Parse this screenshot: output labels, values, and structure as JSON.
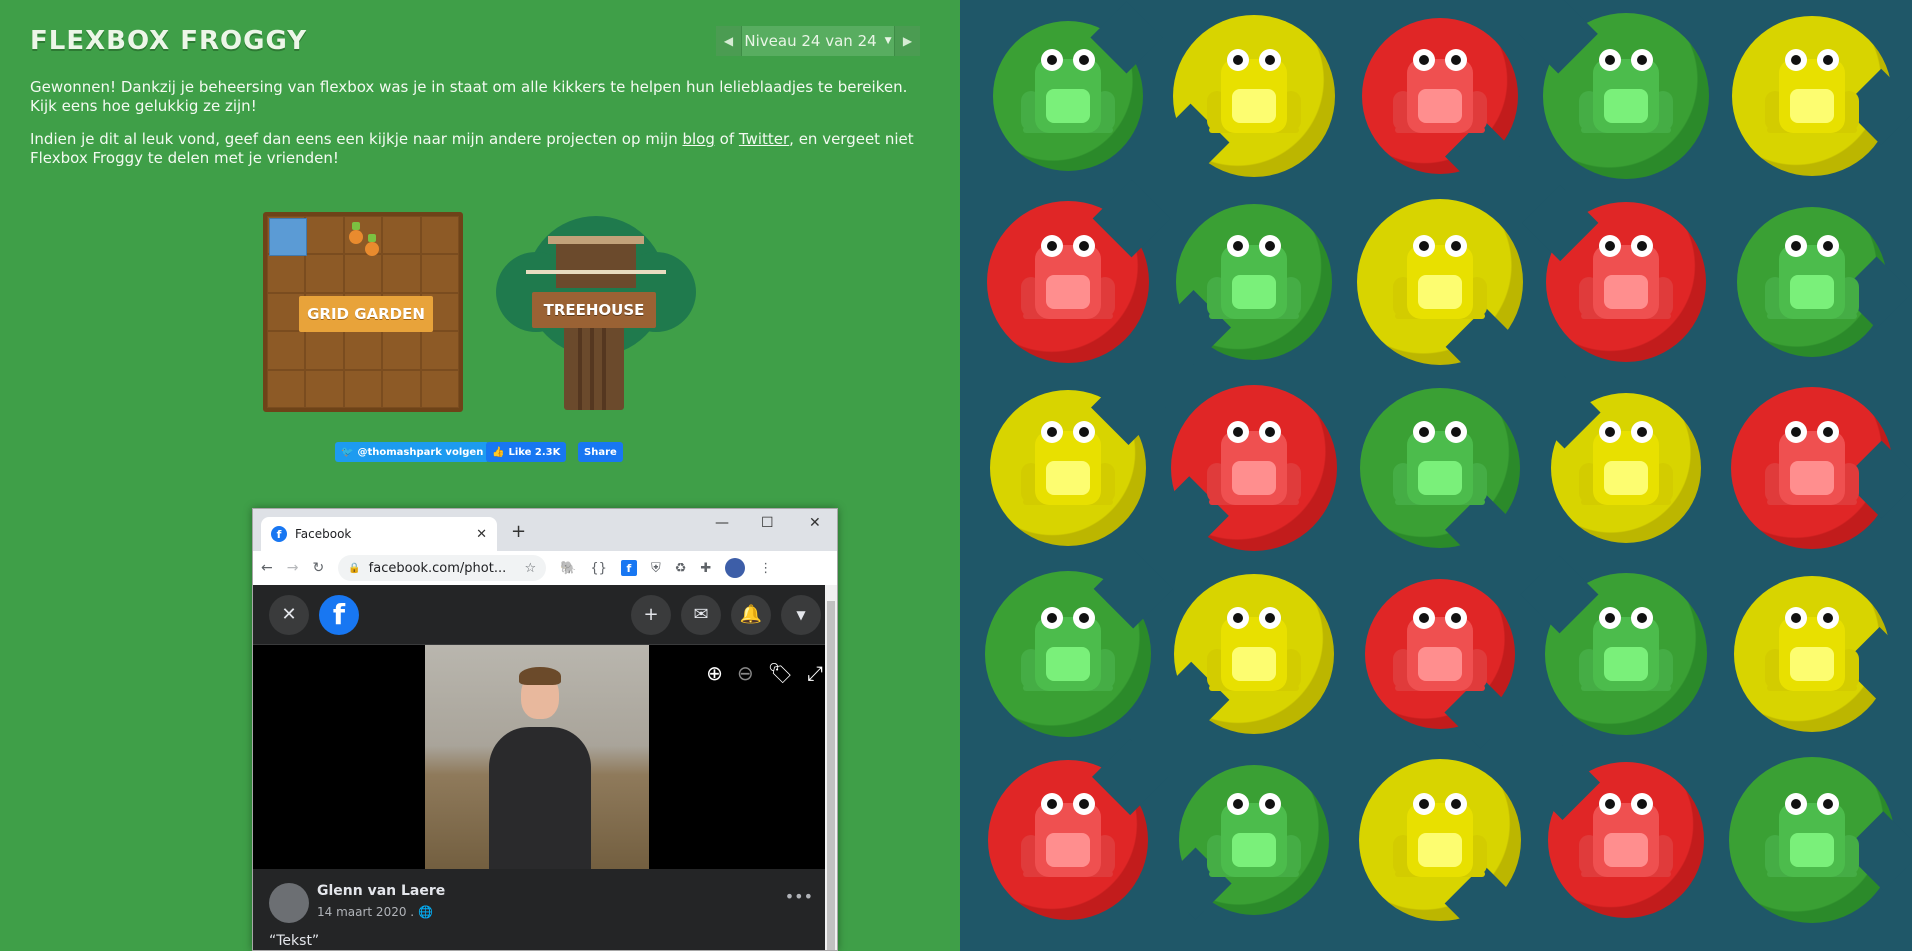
{
  "game": {
    "title": "FLEXBOX FROGGY",
    "level_label": "Niveau 24 van 24",
    "win_text": "Gewonnen! Dankzij je beheersing van flexbox was je in staat om alle kikkers te helpen hun lelieblaadjes te bereiken. Kijk eens hoe gelukkig ze zijn!",
    "share_text_pre": "Indien je dit al leuk vond, geef dan eens een kijkje naar mijn andere projecten op mijn ",
    "share_link_blog": "blog",
    "share_text_mid": " of ",
    "share_link_twitter": "Twitter",
    "share_text_post": ", en vergeet niet Flexbox Froggy te delen met je vrienden!"
  },
  "promos": {
    "grid_garden": "GRID GARDEN",
    "treehouse": "TREEHOUSE"
  },
  "social": {
    "twitter_follow": "@thomashpark volgen",
    "fb_like": "Like 2.3K",
    "fb_share": "Share"
  },
  "browser": {
    "tab_title": "Facebook",
    "url": "facebook.com/phot...",
    "post_author": "Glenn van Laere",
    "post_date": "14 maart 2020 .",
    "post_text": "“Tekst”"
  },
  "board": {
    "colors": {
      "green": "#3aa034",
      "green_dark": "#2b8a2a",
      "yellow": "#d8d400",
      "yellow_dark": "#bcb600",
      "red": "#e02626",
      "red_dark": "#c21c1c",
      "water": "#1f5768"
    },
    "rows": [
      [
        "green",
        "yellow",
        "red",
        "green",
        "yellow"
      ],
      [
        "red",
        "green",
        "yellow",
        "red",
        "green"
      ],
      [
        "yellow",
        "red",
        "green",
        "yellow",
        "red"
      ],
      [
        "green",
        "yellow",
        "red",
        "green",
        "yellow"
      ],
      [
        "red",
        "green",
        "yellow",
        "red",
        "green"
      ]
    ]
  }
}
